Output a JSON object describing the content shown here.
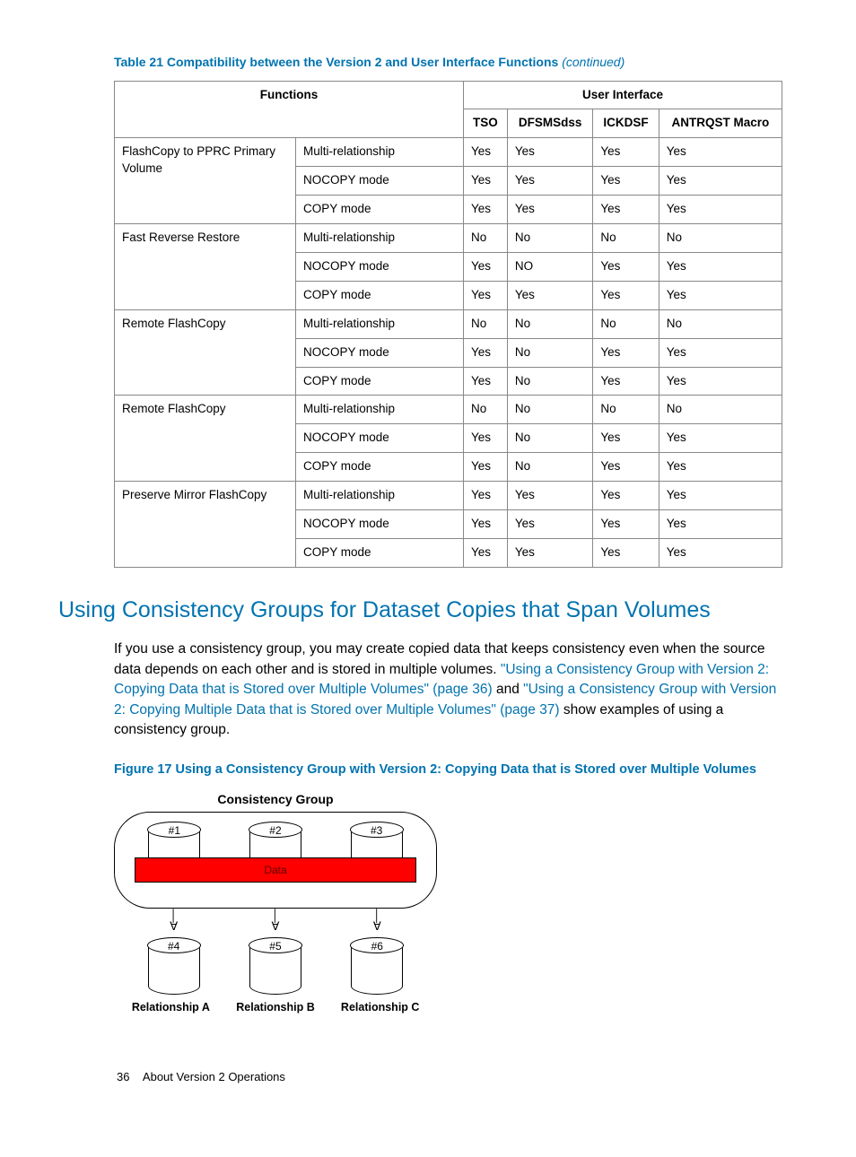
{
  "table": {
    "caption": "Table 21 Compatibility between the Version 2 and User Interface Functions",
    "continued": "(continued)",
    "header_functions": "Functions",
    "header_ui": "User Interface",
    "sub_headers": [
      "TSO",
      "DFSMSdss",
      "ICKDSF",
      "ANTRQST Macro"
    ],
    "groups": [
      {
        "func": "FlashCopy to PPRC Primary Volume",
        "rows": [
          {
            "mode": "Multi-relationship",
            "vals": [
              "Yes",
              "Yes",
              "Yes",
              "Yes"
            ]
          },
          {
            "mode": "NOCOPY mode",
            "vals": [
              "Yes",
              "Yes",
              "Yes",
              "Yes"
            ]
          },
          {
            "mode": "COPY mode",
            "vals": [
              "Yes",
              "Yes",
              "Yes",
              "Yes"
            ]
          }
        ]
      },
      {
        "func": "Fast Reverse Restore",
        "rows": [
          {
            "mode": "Multi-relationship",
            "vals": [
              "No",
              "No",
              "No",
              "No"
            ]
          },
          {
            "mode": "NOCOPY mode",
            "vals": [
              "Yes",
              "NO",
              "Yes",
              "Yes"
            ]
          },
          {
            "mode": "COPY mode",
            "vals": [
              "Yes",
              "Yes",
              "Yes",
              "Yes"
            ]
          }
        ]
      },
      {
        "func": "Remote FlashCopy",
        "rows": [
          {
            "mode": "Multi-relationship",
            "vals": [
              "No",
              "No",
              "No",
              "No"
            ]
          },
          {
            "mode": "NOCOPY mode",
            "vals": [
              "Yes",
              "No",
              "Yes",
              "Yes"
            ]
          },
          {
            "mode": "COPY mode",
            "vals": [
              "Yes",
              "No",
              "Yes",
              "Yes"
            ]
          }
        ]
      },
      {
        "func": "Remote FlashCopy",
        "rows": [
          {
            "mode": "Multi-relationship",
            "vals": [
              "No",
              "No",
              "No",
              "No"
            ]
          },
          {
            "mode": "NOCOPY mode",
            "vals": [
              "Yes",
              "No",
              "Yes",
              "Yes"
            ]
          },
          {
            "mode": "COPY mode",
            "vals": [
              "Yes",
              "No",
              "Yes",
              "Yes"
            ]
          }
        ]
      },
      {
        "func": "Preserve Mirror FlashCopy",
        "rows": [
          {
            "mode": "Multi-relationship",
            "vals": [
              "Yes",
              "Yes",
              "Yes",
              "Yes"
            ]
          },
          {
            "mode": "NOCOPY mode",
            "vals": [
              "Yes",
              "Yes",
              "Yes",
              "Yes"
            ]
          },
          {
            "mode": "COPY mode",
            "vals": [
              "Yes",
              "Yes",
              "Yes",
              "Yes"
            ]
          }
        ]
      }
    ]
  },
  "section_heading": "Using Consistency Groups for Dataset Copies that Span Volumes",
  "paragraph": {
    "part1": "If you use a consistency group, you may create copied data that keeps consistency even when the source data depends on each other and is stored in multiple volumes. ",
    "link1": "\"Using a Consistency Group with Version 2: Copying Data that is Stored over Multiple Volumes\" (page 36)",
    "mid": " and ",
    "link2": "\"Using a Consistency Group with Version 2: Copying Multiple Data that is Stored over Multiple Volumes\" (page 37)",
    "part2": " show examples of using a consistency group."
  },
  "figure_caption": "Figure 17 Using a Consistency Group with Version 2: Copying Data that is Stored over Multiple Volumes",
  "figure": {
    "group_title": "Consistency Group",
    "top_labels": [
      "#1",
      "#2",
      "#3"
    ],
    "data_label": "Data",
    "bottom_labels": [
      "#4",
      "#5",
      "#6"
    ],
    "relationships": [
      "Relationship A",
      "Relationship B",
      "Relationship C"
    ]
  },
  "footer": {
    "page": "36",
    "title": "About Version 2 Operations"
  }
}
